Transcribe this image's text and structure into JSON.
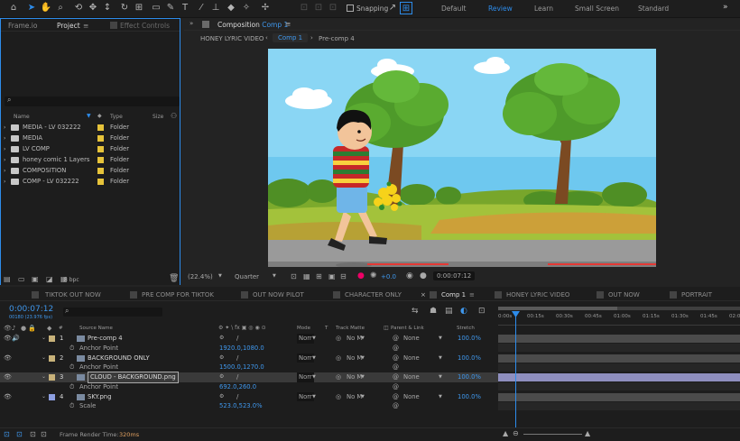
{
  "toolbar": {
    "snapping_label": "Snapping",
    "workspaces": [
      "Default",
      "Review",
      "Learn",
      "Small Screen",
      "Standard"
    ],
    "active_workspace": "Review",
    "overflow": "»"
  },
  "project_panel": {
    "tabs": [
      "Frame.io",
      "Project",
      "Effect Controls"
    ],
    "menu_icon": "≡",
    "search_placeholder": "",
    "columns": {
      "name": "Name",
      "type": "Type",
      "size": "Size"
    },
    "items": [
      {
        "name": "MEDIA - LV 032222",
        "type": "Folder"
      },
      {
        "name": "MEDIA",
        "type": "Folder"
      },
      {
        "name": "LV COMP",
        "type": "Folder"
      },
      {
        "name": "honey comic 1 Layers",
        "type": "Folder"
      },
      {
        "name": "COMPOSITION",
        "type": "Folder"
      },
      {
        "name": "COMP - LV 032222",
        "type": "Folder"
      }
    ],
    "bpc": "8 bpc"
  },
  "viewer": {
    "panel_title_prefix": "Composition",
    "panel_title_comp": "Comp 1",
    "breadcrumbs": [
      "HONEY LYRIC VIDEO",
      "Comp 1",
      "Pre-comp 4"
    ],
    "active_breadcrumb": "Comp 1",
    "zoom": "(22.4%)",
    "resolution": "Quarter",
    "exposure": "+0.0",
    "timecode": "0:00:07:12"
  },
  "timeline": {
    "tabs": [
      "TIKTOK OUT NOW",
      "PRE COMP FOR TIKTOK",
      "OUT NOW PILOT",
      "CHARACTER ONLY",
      "Comp 1",
      "HONEY LYRIC VIDEO",
      "OUT NOW",
      "PORTRAIT"
    ],
    "active_tab": "Comp 1",
    "current_time": "0:00:07:12",
    "frame_info": "00180 (23.976 fps)",
    "columns": {
      "source_name": "Source Name",
      "mode": "Mode",
      "t": "T",
      "track_matte": "Track Matte",
      "parent": "Parent & Link",
      "stretch": "Stretch"
    },
    "ruler": [
      "0:00s",
      "00:15s",
      "00:30s",
      "00:45s",
      "01:00s",
      "01:15s",
      "01:30s",
      "01:45s",
      "02:00"
    ],
    "layers": [
      {
        "num": "1",
        "name": "Pre-comp 4",
        "mode": "Norr",
        "matte": "No M",
        "parent": "None",
        "stretch": "100.0%",
        "prop_name": "Anchor Point",
        "prop_value": "1920.0,1080.0",
        "label_color": "#c8b27a"
      },
      {
        "num": "2",
        "name": "BACKGROUND ONLY",
        "mode": "Norr",
        "matte": "No M",
        "parent": "None",
        "stretch": "100.0%",
        "prop_name": "Anchor Point",
        "prop_value": "1500.0,1270.0",
        "label_color": "#c8b27a"
      },
      {
        "num": "3",
        "name": "CLOUD - BACKGROUND.png",
        "mode": "Norr",
        "matte": "No M",
        "parent": "None",
        "stretch": "100.0%",
        "prop_name": "Anchor Point",
        "prop_value": "692.0,260.0",
        "label_color": "#c8b27a"
      },
      {
        "num": "4",
        "name": "SKY.png",
        "mode": "Norr",
        "matte": "No M",
        "parent": "None",
        "stretch": "100.0%",
        "prop_name": "Scale",
        "prop_value": "523.0,523.0%",
        "label_color": "#8c9ee0"
      }
    ],
    "render_time_label": "Frame Render Time:",
    "render_time_value": "320ms"
  },
  "colors": {
    "accent": "#2d8ceb",
    "sky": "#6ec8ef",
    "grass": "#a3c23b",
    "road": "#9a9a9a"
  }
}
